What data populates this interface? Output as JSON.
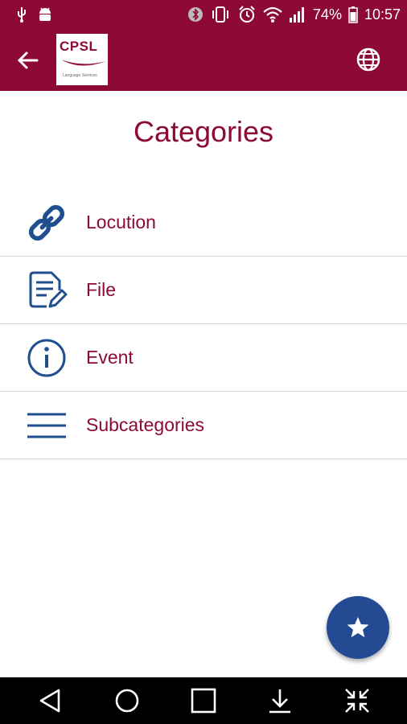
{
  "status_bar": {
    "battery": "74%",
    "time": "10:57"
  },
  "app_bar": {
    "logo_text": "CPSL",
    "logo_subtext": "Language Services"
  },
  "page": {
    "title": "Categories"
  },
  "categories": [
    {
      "label": "Locution",
      "icon": "link-icon"
    },
    {
      "label": "File",
      "icon": "document-edit-icon"
    },
    {
      "label": "Event",
      "icon": "info-icon"
    },
    {
      "label": "Subcategories",
      "icon": "menu-icon"
    }
  ],
  "colors": {
    "brand": "#8c0a33",
    "accent": "#244a93",
    "icon": "#1f4f8f"
  },
  "fab": {
    "icon": "star-icon"
  }
}
